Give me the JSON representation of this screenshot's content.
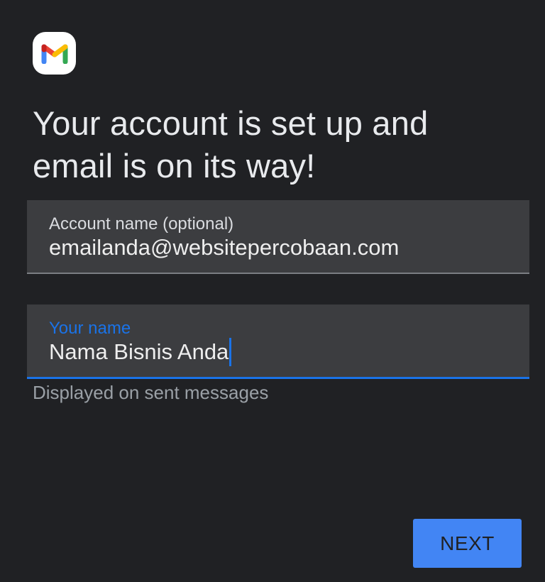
{
  "app": {
    "logo_icon": "gmail-logo-icon",
    "brand_colors": {
      "blue": "#4285F4",
      "red": "#EA4335",
      "yellow": "#FBBC04",
      "green": "#34A853"
    }
  },
  "header": {
    "title": "Your account is set up and email is on its way!"
  },
  "form": {
    "account_name": {
      "label": "Account name (optional)",
      "value": "emailanda@websitepercobaan.com"
    },
    "your_name": {
      "label": "Your name",
      "value": "Nama Bisnis Anda",
      "helper": "Displayed on sent messages",
      "focused": true
    }
  },
  "actions": {
    "next_label": "NEXT"
  },
  "theme": {
    "background": "#202124",
    "field_background": "#3C3D40",
    "accent": "#1A73E8",
    "button": "#4285F4"
  }
}
